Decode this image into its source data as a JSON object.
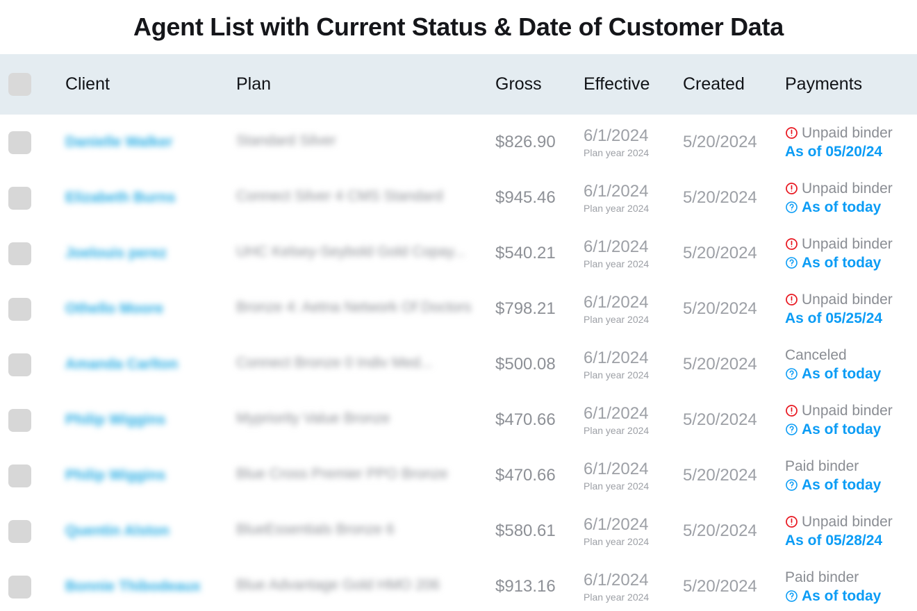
{
  "header": {
    "title": "Agent List with Current Status & Date of Customer Data"
  },
  "table": {
    "columns": [
      {
        "key": "select",
        "label": ""
      },
      {
        "key": "client",
        "label": "Client"
      },
      {
        "key": "plan",
        "label": "Plan"
      },
      {
        "key": "gross",
        "label": "Gross"
      },
      {
        "key": "effective",
        "label": "Effective"
      },
      {
        "key": "created",
        "label": "Created"
      },
      {
        "key": "payments",
        "label": "Payments"
      }
    ],
    "rows": [
      {
        "client": "Danielle Walker",
        "plan": "Standard Silver",
        "gross": "$826.90",
        "effective": "6/1/2024",
        "effective_sub": "Plan year 2024",
        "created": "5/20/2024",
        "status": "Unpaid binder",
        "status_icon": "alert-circle-icon",
        "asof": "As of 05/20/24",
        "asof_icon": "none"
      },
      {
        "client": "Elizabeth Burns",
        "plan": "Connect Silver 4 CMS Standard",
        "gross": "$945.46",
        "effective": "6/1/2024",
        "effective_sub": "Plan year 2024",
        "created": "5/20/2024",
        "status": "Unpaid binder",
        "status_icon": "alert-circle-icon",
        "asof": "As of today",
        "asof_icon": "help-circle-icon"
      },
      {
        "client": "Joelouis perez",
        "plan": "UHC Kelsey-Seybold Gold Copay...",
        "gross": "$540.21",
        "effective": "6/1/2024",
        "effective_sub": "Plan year 2024",
        "created": "5/20/2024",
        "status": "Unpaid binder",
        "status_icon": "alert-circle-icon",
        "asof": "As of today",
        "asof_icon": "help-circle-icon"
      },
      {
        "client": "Othello Moore",
        "plan": "Bronze 4: Aetna Network Of Doctors",
        "gross": "$798.21",
        "effective": "6/1/2024",
        "effective_sub": "Plan year 2024",
        "created": "5/20/2024",
        "status": "Unpaid binder",
        "status_icon": "alert-circle-icon",
        "asof": "As of 05/25/24",
        "asof_icon": "none"
      },
      {
        "client": "Amanda Carlton",
        "plan": "Connect Bronze 0 Indiv Med...",
        "gross": "$500.08",
        "effective": "6/1/2024",
        "effective_sub": "Plan year 2024",
        "created": "5/20/2024",
        "status": "Canceled",
        "status_icon": "none",
        "asof": "As of today",
        "asof_icon": "help-circle-icon"
      },
      {
        "client": "Philip Wiggins",
        "plan": "Mypriority Value Bronze",
        "gross": "$470.66",
        "effective": "6/1/2024",
        "effective_sub": "Plan year 2024",
        "created": "5/20/2024",
        "status": "Unpaid binder",
        "status_icon": "alert-circle-icon",
        "asof": "As of today",
        "asof_icon": "help-circle-icon"
      },
      {
        "client": "Philip Wiggins",
        "plan": "Blue Cross Premier PPO Bronze",
        "gross": "$470.66",
        "effective": "6/1/2024",
        "effective_sub": "Plan year 2024",
        "created": "5/20/2024",
        "status": "Paid binder",
        "status_icon": "none",
        "asof": "As of today",
        "asof_icon": "help-circle-icon"
      },
      {
        "client": "Quentin Alston",
        "plan": "BlueEssentials Bronze 6",
        "gross": "$580.61",
        "effective": "6/1/2024",
        "effective_sub": "Plan year 2024",
        "created": "5/20/2024",
        "status": "Unpaid binder",
        "status_icon": "alert-circle-icon",
        "asof": "As of 05/28/24",
        "asof_icon": "none"
      },
      {
        "client": "Bonnie Thibodeaux",
        "plan": "Blue Advantage Gold HMO 206",
        "gross": "$913.16",
        "effective": "6/1/2024",
        "effective_sub": "Plan year 2024",
        "created": "5/20/2024",
        "status": "Paid binder",
        "status_icon": "none",
        "asof": "As of today",
        "asof_icon": "help-circle-icon"
      }
    ]
  },
  "colors": {
    "header_bg": "#e4ecf1",
    "link_blue": "#0b9cf5",
    "client_blue": "#29ade4",
    "muted_gray": "#8d9096",
    "alert_red": "#e8161f",
    "title_black": "#15161a"
  }
}
